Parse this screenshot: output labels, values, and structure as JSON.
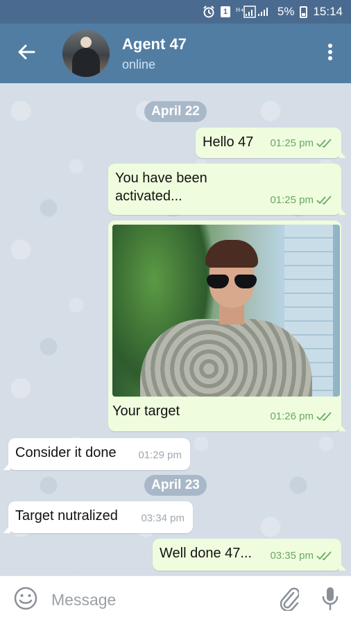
{
  "status_bar": {
    "battery": "5%",
    "time": "15:14",
    "sim_label": "1"
  },
  "header": {
    "title": "Agent 47",
    "status": "online"
  },
  "dates": [
    "April 22",
    "April 23"
  ],
  "messages": [
    {
      "text": "Hello 47",
      "time": "01:25 pm",
      "direction": "out",
      "read": true
    },
    {
      "text": "You have been activated...",
      "time": "01:25 pm",
      "direction": "out",
      "read": true
    },
    {
      "text": "Your target",
      "time": "01:26 pm",
      "direction": "out",
      "read": true,
      "has_photo": true
    },
    {
      "text": "Consider it done",
      "time": "01:29 pm",
      "direction": "in"
    },
    {
      "text": "Target nutralized",
      "time": "03:34 pm",
      "direction": "in"
    },
    {
      "text": "Well done 47...",
      "time": "03:35 pm",
      "direction": "out",
      "read": true
    }
  ],
  "composer": {
    "placeholder": "Message"
  },
  "colors": {
    "header": "#527da3",
    "statusbar": "#4a6b8f",
    "outgoing_bubble": "#effdde",
    "read_ticks": "#6aa865"
  },
  "icons": [
    "alarm-icon",
    "sim-icon",
    "signal-icon",
    "battery-icon",
    "back-arrow-icon",
    "more-vert-icon",
    "emoji-icon",
    "attach-icon",
    "mic-icon",
    "double-check-icon"
  ]
}
